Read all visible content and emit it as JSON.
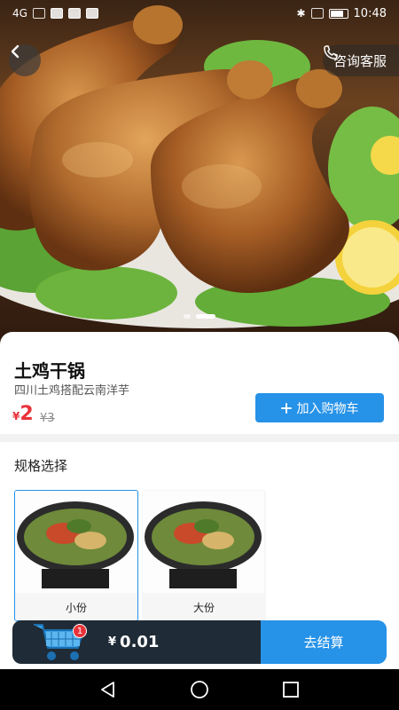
{
  "status_bar": {
    "left_indicators": "4G",
    "time": "10:48"
  },
  "header": {
    "back_icon": "chevron-left-icon",
    "consult_label": "咨询客服",
    "consult_icon": "phone-icon"
  },
  "carousel": {
    "slide_count": 2,
    "active_index": 1
  },
  "product": {
    "title": "土鸡干锅",
    "subtitle": "四川土鸡搭配云南洋芋",
    "currency": "¥",
    "price": "2",
    "original_price": "¥3",
    "add_to_cart_label": "加入购物车"
  },
  "spec": {
    "title": "规格选择",
    "options": [
      {
        "label": "小份",
        "selected": true
      },
      {
        "label": "大份",
        "selected": false
      }
    ]
  },
  "cart": {
    "badge_count": "1",
    "currency": "¥",
    "total": "0.01",
    "checkout_label": "去结算"
  },
  "colors": {
    "accent": "#2692e8",
    "price": "#e8333a",
    "cart_bar": "#1f2b36"
  }
}
